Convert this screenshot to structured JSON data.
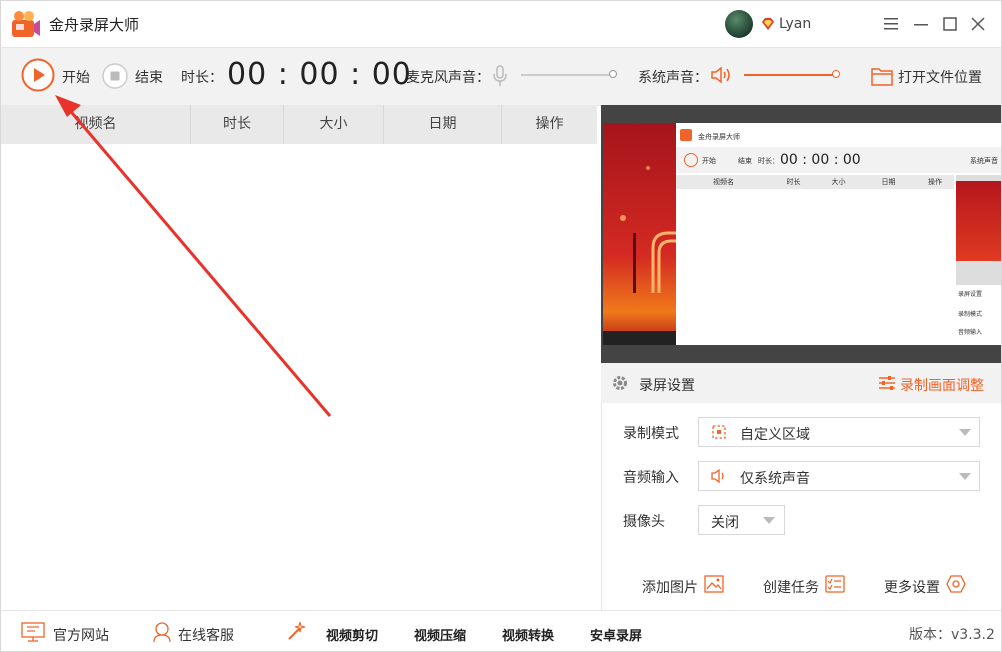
{
  "app": {
    "title": "金舟录屏大师",
    "username": "Lyan"
  },
  "toolbar": {
    "start_label": "开始",
    "stop_label": "结束",
    "duration_label": "时长：",
    "timer": "00 : 00 : 00",
    "mic_label": "麦克风声音：",
    "mic_level": 0.0,
    "system_label": "系统声音：",
    "system_level": 1.0,
    "open_folder_label": "打开文件位置"
  },
  "table": {
    "columns": [
      "视频名",
      "时长",
      "大小",
      "日期",
      "操作"
    ],
    "rows": []
  },
  "settings": {
    "header": "录屏设置",
    "adjust_label": "录制画面调整",
    "mode_label": "录制模式",
    "mode_value": "自定义区域",
    "audio_label": "音频输入",
    "audio_value": "仅系统声音",
    "camera_label": "摄像头",
    "camera_value": "关闭",
    "add_image": "添加图片",
    "create_task": "创建任务",
    "more_settings": "更多设置"
  },
  "bottom": {
    "website": "官方网站",
    "support": "在线客服",
    "video_cut": "视频剪切",
    "video_compress": "视频压缩",
    "video_convert": "视频转换",
    "android_record": "安卓录屏",
    "version": "版本：v3.3.2"
  },
  "preview_mini": {
    "title": "金舟录屏大师",
    "start": "开始",
    "stop": "结束",
    "duration": "时长：",
    "timer": "00 : 00 : 00",
    "system": "系统声音",
    "columns": [
      "视频名",
      "时长",
      "大小",
      "日期",
      "操作"
    ],
    "settings": "录屏设置",
    "mode": "录制模式",
    "audio": "音频输入"
  },
  "colors": {
    "accent": "#f0642a",
    "toolbar_bg": "#f2f2f2",
    "preview_bg": "#444444"
  }
}
